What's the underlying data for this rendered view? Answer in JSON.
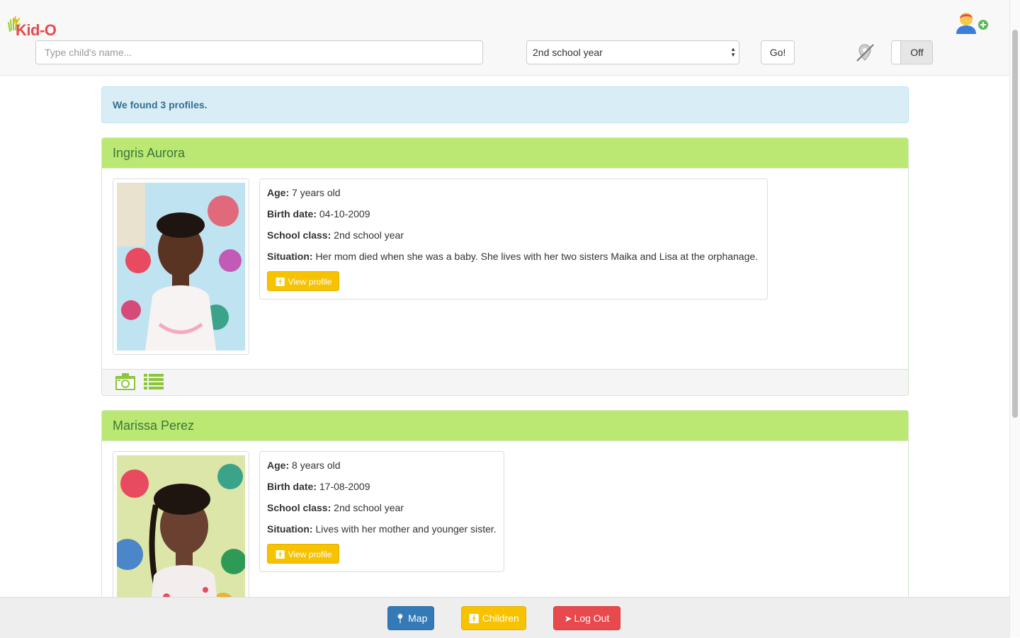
{
  "app": {
    "logo_text": "Kid-O"
  },
  "header": {
    "search_placeholder": "Type child's name...",
    "class_select_value": "2nd school year",
    "go_label": "Go!",
    "toggle_label": "Off"
  },
  "alert": {
    "text": "We found 3 profiles."
  },
  "profiles": [
    {
      "name": "Ingris Aurora",
      "age_label": "Age:",
      "age": "7 years old",
      "birth_label": "Birth date:",
      "birth": "04-10-2009",
      "class_label": "School class:",
      "class": "2nd school year",
      "situation_label": "Situation:",
      "situation": "Her mom died when she was a baby. She lives with her two sisters Maika and Lisa at the orphanage.",
      "view_label": "View profile"
    },
    {
      "name": "Marissa Perez",
      "age_label": "Age:",
      "age": "8 years old",
      "birth_label": "Birth date:",
      "birth": "17-08-2009",
      "class_label": "School class:",
      "class": "2nd school year",
      "situation_label": "Situation:",
      "situation": "Lives with her mother and younger sister.",
      "view_label": "View profile"
    }
  ],
  "bottom_nav": {
    "map_label": "Map",
    "children_label": "Children",
    "logout_label": "Log Out"
  },
  "colors": {
    "panel_heading": "#bbe872",
    "alert_bg": "#d9edf7",
    "yellow": "#f7c300",
    "blue": "#337ab7",
    "red": "#e8494d"
  }
}
